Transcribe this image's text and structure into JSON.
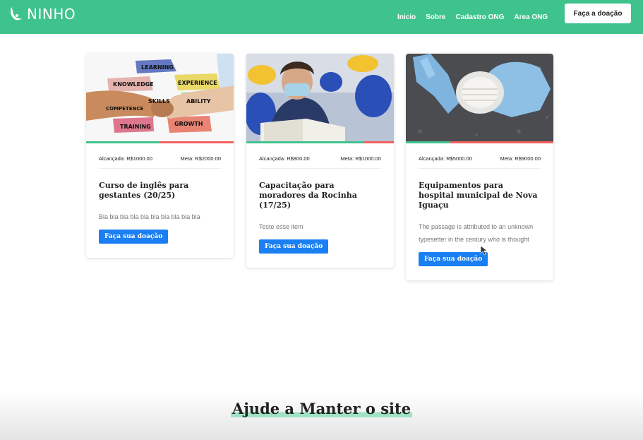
{
  "brand": {
    "name": "NINHO"
  },
  "nav": {
    "links": [
      "Inicio",
      "Sobre",
      "Cadastro ONG",
      "Area ONG"
    ],
    "cta": "Faça a doação"
  },
  "colors": {
    "primary_green": "#3fc38c",
    "donate_blue": "#1a7ff2",
    "progress_red": "#f06060"
  },
  "cards": [
    {
      "image": "handshake-skills-illustration",
      "reached": "Alcançada: R$1000.00",
      "goal": "Meta: R$2000.00",
      "progress": 0.5,
      "title": "Curso de inglês para gestantes (20/25)",
      "description": "Bla bla bla bla bla bla bla bla bla bla",
      "button": "Faça sua doação"
    },
    {
      "image": "student-with-mask-reading",
      "reached": "Alcançada: R$800.00",
      "goal": "Meta: R$1000.00",
      "progress": 0.8,
      "title": "Capacitação para moradores da Rocinha (17/25)",
      "description": "Teste esse item",
      "button": "Faça sua doação"
    },
    {
      "image": "gloves-and-mask-on-asphalt",
      "reached": "Alcançada: R$5000.00",
      "goal": "Meta: R$9000.00",
      "progress": 0.3,
      "title": "Equipamentos para hospital municipal de Nova Iguaçu",
      "description": "The passage is attributed to an unknown typesetter in the century who is thought",
      "button": "Faça sua doação"
    }
  ],
  "section": {
    "title": "Ajude a Manter o site"
  },
  "image_words": [
    "LEARNING",
    "KNOWLEDGE",
    "EXPERIENCE",
    "SKILLS",
    "ABILITY",
    "COMPETENCE",
    "TRAINING",
    "GROWTH"
  ]
}
